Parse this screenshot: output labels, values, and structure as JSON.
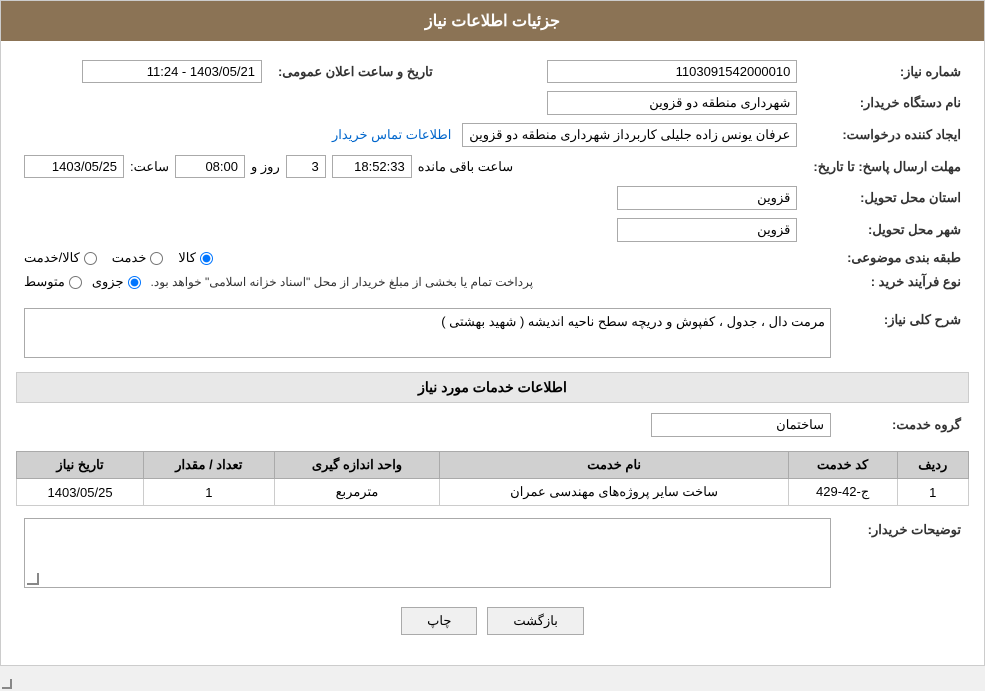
{
  "header": {
    "title": "جزئیات اطلاعات نیاز"
  },
  "fields": {
    "need_number_label": "شماره نیاز:",
    "need_number_value": "1103091542000010",
    "buyer_org_label": "نام دستگاه خریدار:",
    "buyer_org_value": "شهرداری منطقه دو قزوین",
    "requester_label": "ایجاد کننده درخواست:",
    "requester_value": "عرفان یونس زاده جلیلی کاربرداز شهرداری منطقه دو قزوین",
    "contact_link": "اطلاعات تماس خریدار",
    "deadline_label": "مهلت ارسال پاسخ: تا تاریخ:",
    "deadline_date": "1403/05/25",
    "deadline_time_label": "ساعت:",
    "deadline_time": "08:00",
    "deadline_days_label": "روز و",
    "deadline_days": "3",
    "deadline_remaining_label": "ساعت باقی مانده",
    "deadline_remaining": "18:52:33",
    "announce_date_label": "تاریخ و ساعت اعلان عمومی:",
    "announce_date_value": "1403/05/21 - 11:24",
    "province_label": "استان محل تحویل:",
    "province_value": "قزوین",
    "city_label": "شهر محل تحویل:",
    "city_value": "قزوین",
    "category_label": "طبقه بندی موضوعی:",
    "category_kala": "کالا",
    "category_khedmat": "خدمت",
    "category_kala_khedmat": "کالا/خدمت",
    "process_label": "نوع فرآیند خرید :",
    "process_jozvi": "جزوی",
    "process_motavasset": "متوسط",
    "process_note": "پرداخت تمام یا بخشی از مبلغ خریدار از محل \"اسناد خزانه اسلامی\" خواهد بود.",
    "need_description_label": "شرح کلی نیاز:",
    "need_description_value": "مرمت دال ، جدول ، کفپوش و دریچه سطح ناحیه اندیشه ( شهید بهشتی )",
    "services_section_label": "اطلاعات خدمات مورد نیاز",
    "service_group_label": "گروه خدمت:",
    "service_group_value": "ساختمان",
    "table_headers": {
      "row_number": "ردیف",
      "service_code": "کد خدمت",
      "service_name": "نام خدمت",
      "unit": "واحد اندازه گیری",
      "quantity": "تعداد / مقدار",
      "need_date": "تاریخ نیاز"
    },
    "table_rows": [
      {
        "row": "1",
        "code": "ج-42-429",
        "name": "ساخت سایر پروژه‌های مهندسی عمران",
        "unit": "مترمربع",
        "quantity": "1",
        "date": "1403/05/25"
      }
    ],
    "buyer_notes_label": "توضیحات خریدار:",
    "buttons": {
      "back": "بازگشت",
      "print": "چاپ"
    }
  }
}
